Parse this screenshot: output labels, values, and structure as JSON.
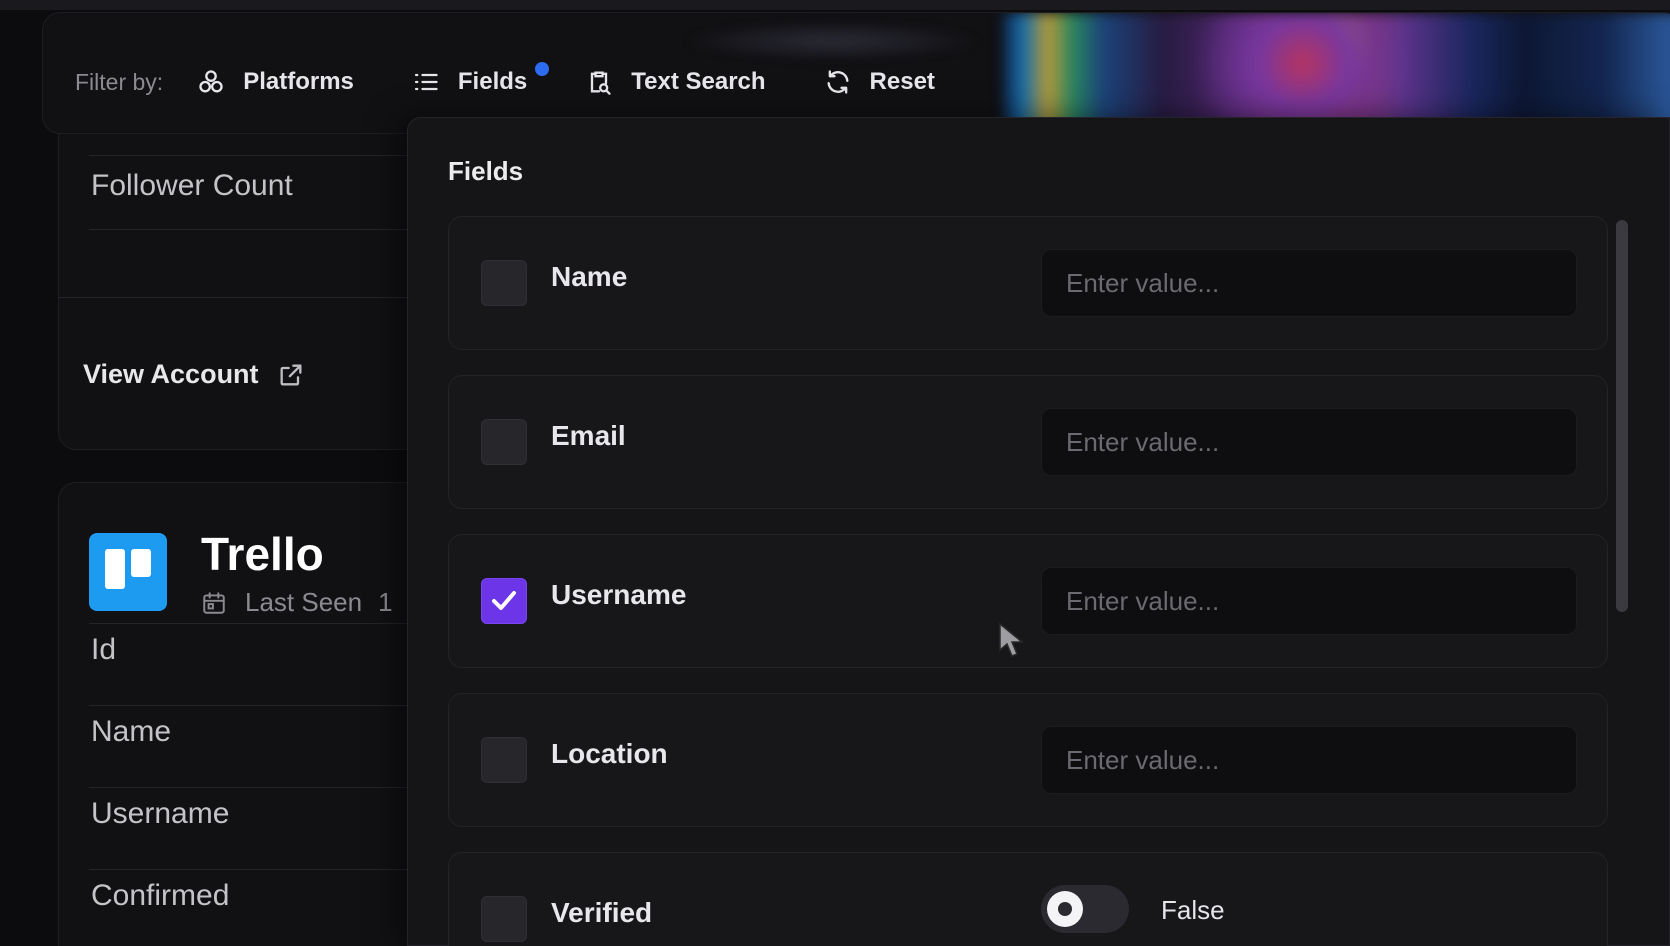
{
  "filter_bar": {
    "label": "Filter by:",
    "items": [
      {
        "label": "Platforms",
        "icon": "platforms-icon"
      },
      {
        "label": "Fields",
        "icon": "list-icon",
        "has_badge": true
      },
      {
        "label": "Text Search",
        "icon": "clipboard-search-icon"
      },
      {
        "label": "Reset",
        "icon": "refresh-icon"
      }
    ],
    "badge_color": "#2d6cf0"
  },
  "background_cards": {
    "card1": {
      "row_label": "Follower Count",
      "link_label": "View Account"
    },
    "card2": {
      "platform_name": "Trello",
      "last_seen_label": "Last Seen",
      "last_seen_value_partial": "1",
      "rows": [
        "Id",
        "Name",
        "Username",
        "Confirmed"
      ]
    }
  },
  "fields_panel": {
    "title": "Fields",
    "rows": [
      {
        "label": "Name",
        "checked": false,
        "type": "text",
        "placeholder": "Enter value..."
      },
      {
        "label": "Email",
        "checked": false,
        "type": "text",
        "placeholder": "Enter value..."
      },
      {
        "label": "Username",
        "checked": true,
        "type": "text",
        "placeholder": "Enter value..."
      },
      {
        "label": "Location",
        "checked": false,
        "type": "text",
        "placeholder": "Enter value..."
      },
      {
        "label": "Verified",
        "checked": false,
        "type": "toggle",
        "value": "False"
      }
    ],
    "accent_color": "#6d35e8"
  }
}
